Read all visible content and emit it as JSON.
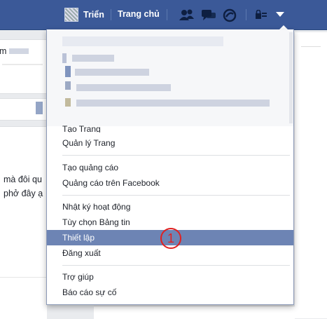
{
  "topbar": {
    "profile_name": "Triển",
    "home_label": "Trang chủ",
    "icons": [
      "friend-requests-icon",
      "messages-icon",
      "notifications-icon",
      "privacy-shortcuts-icon",
      "account-menu-caret-icon"
    ]
  },
  "background": {
    "snippet_top": "m",
    "post_line1": "mà đôi qu",
    "post_line2": "phở đây ạ"
  },
  "menu": {
    "partial_item": "Tạo Trang",
    "group_pages": [
      "Quản lý Trang"
    ],
    "group_ads": [
      "Tạo quảng cáo",
      "Quảng cáo trên Facebook"
    ],
    "group_account": [
      "Nhật ký hoạt động",
      "Tùy chọn Bảng tin",
      "Thiết lập",
      "Đăng xuất"
    ],
    "group_help": [
      "Trợ giúp",
      "Báo cáo sự cố"
    ],
    "selected_item": "Thiết lập"
  },
  "annotation": {
    "marker_label": "1"
  },
  "colors": {
    "topbar": "#3b5998",
    "highlight": "#6d84b4",
    "annotation": "#e02020"
  }
}
